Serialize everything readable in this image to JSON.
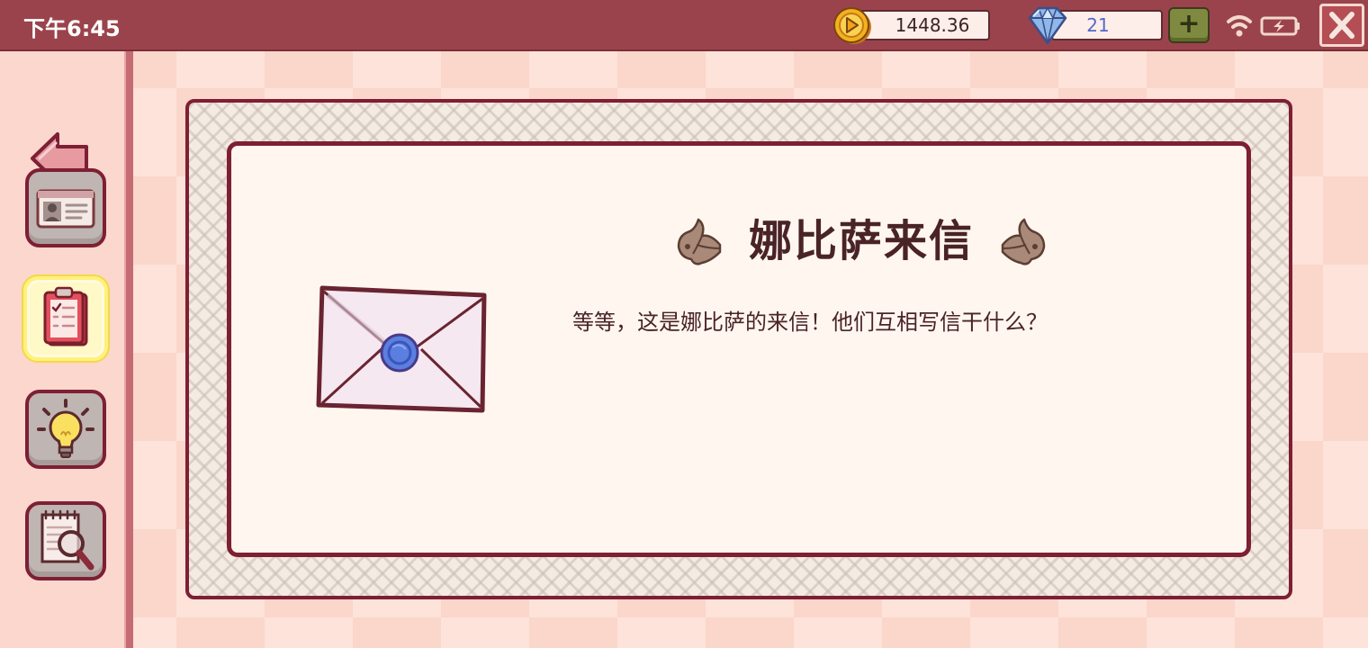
{
  "status_bar": {
    "time": "下午6:45"
  },
  "currency": {
    "coins": "1448.36",
    "gems": "21",
    "add_label": "+"
  },
  "icons": {
    "coin": "coin-icon",
    "gem": "diamond-icon",
    "wifi": "wifi-icon",
    "battery": "battery-charging-icon",
    "close": "close-icon",
    "back": "back-arrow-icon",
    "profile": "id-card-icon",
    "tasks": "clipboard-checklist-icon",
    "hint": "lightbulb-icon",
    "investigate": "notepad-magnifier-icon",
    "letter": "sealed-envelope-icon",
    "ornament": "fleur-ornament-icon"
  },
  "sidebar": {
    "active_item": "tasks"
  },
  "dialog": {
    "title": "娜比萨来信",
    "message": "等等，这是娜比萨的来信！他们互相写信干什么？"
  },
  "colors": {
    "topbar": "#9b434c",
    "border": "#7e1f34",
    "panel": "#fff7ef",
    "text": "#4a2327",
    "gem_text": "#5569c8",
    "active_highlight": "#fff17a"
  }
}
